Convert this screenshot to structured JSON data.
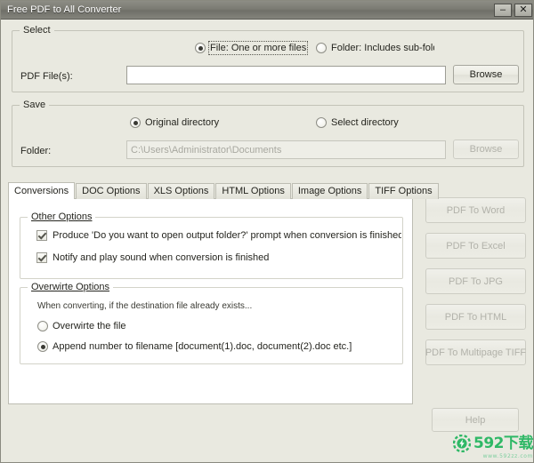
{
  "window": {
    "title": "Free PDF to All Converter",
    "minimize_label": "–",
    "close_label": "✕"
  },
  "select_group": {
    "title": "Select",
    "file_radio_label": "File:  One or more files",
    "folder_radio_label": "Folder: Includes sub-folders",
    "pdf_files_label": "PDF File(s):",
    "pdf_files_value": "",
    "pdf_files_placeholder": "",
    "browse_label": "Browse"
  },
  "save_group": {
    "title": "Save",
    "original_dir_label": "Original directory",
    "select_dir_label": "Select directory",
    "folder_label": "Folder:",
    "folder_value": "C:\\Users\\Administrator\\Documents",
    "browse_label": "Browse"
  },
  "tabs": [
    {
      "label": "Conversions",
      "active": true
    },
    {
      "label": "DOC Options",
      "active": false
    },
    {
      "label": "XLS Options",
      "active": false
    },
    {
      "label": "HTML Options",
      "active": false
    },
    {
      "label": "Image Options",
      "active": false
    },
    {
      "label": "TIFF Options",
      "active": false
    }
  ],
  "other_options": {
    "title": "Other Options",
    "produce_prompt_label": "Produce 'Do you want to open output folder?' prompt when conversion is finished",
    "notify_sound_label": "Notify and play sound when conversion is finished"
  },
  "overwrite_options": {
    "title": "Overwirte Options",
    "hint": "When converting, if the destination file already exists...",
    "overwrite_label": "Overwirte the file",
    "append_label": "Append number to filename  [document(1).doc, document(2).doc etc.]"
  },
  "action_buttons": [
    {
      "label": "PDF To Word"
    },
    {
      "label": "PDF To Excel"
    },
    {
      "label": "PDF To JPG"
    },
    {
      "label": "PDF To HTML"
    },
    {
      "label": "PDF To Multipage TIFF"
    }
  ],
  "help_button": {
    "label": "Help"
  },
  "watermark": {
    "text": "592下载",
    "url": "www.592zz.com",
    "color": "#2fb866"
  }
}
